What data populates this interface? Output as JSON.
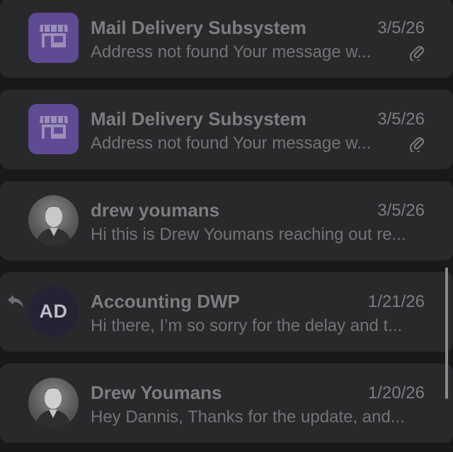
{
  "messages": [
    {
      "sender": "Mail Delivery Subsystem",
      "date": "3/5/26",
      "preview": "Address not found Your message w...",
      "avatar_icon": "store-icon",
      "has_attachment": true
    },
    {
      "sender": "Mail Delivery Subsystem",
      "date": "3/5/26",
      "preview": "Address not found Your message w...",
      "avatar_icon": "store-icon",
      "has_attachment": true
    },
    {
      "sender": "drew youmans",
      "date": "3/5/26",
      "preview": "Hi this is Drew Youmans reaching out re...",
      "avatar_icon": "profile-photo",
      "has_attachment": false
    },
    {
      "sender": "Accounting DWP",
      "date": "1/21/26",
      "preview": "Hi there, I’m so sorry for the delay and t...",
      "avatar_initials": "AD",
      "replied": true,
      "has_attachment": false
    },
    {
      "sender": "Drew Youmans",
      "date": "1/20/26",
      "preview": "Hey Dannis, Thanks for the update, and...",
      "avatar_icon": "profile-photo",
      "has_attachment": false
    }
  ],
  "colors": {
    "background": "#19191b",
    "card": "#29292c",
    "store_avatar": "#5f4a94",
    "initials_avatar": "#232334",
    "text_primary": "#7d7d80",
    "text_secondary": "#737376"
  }
}
